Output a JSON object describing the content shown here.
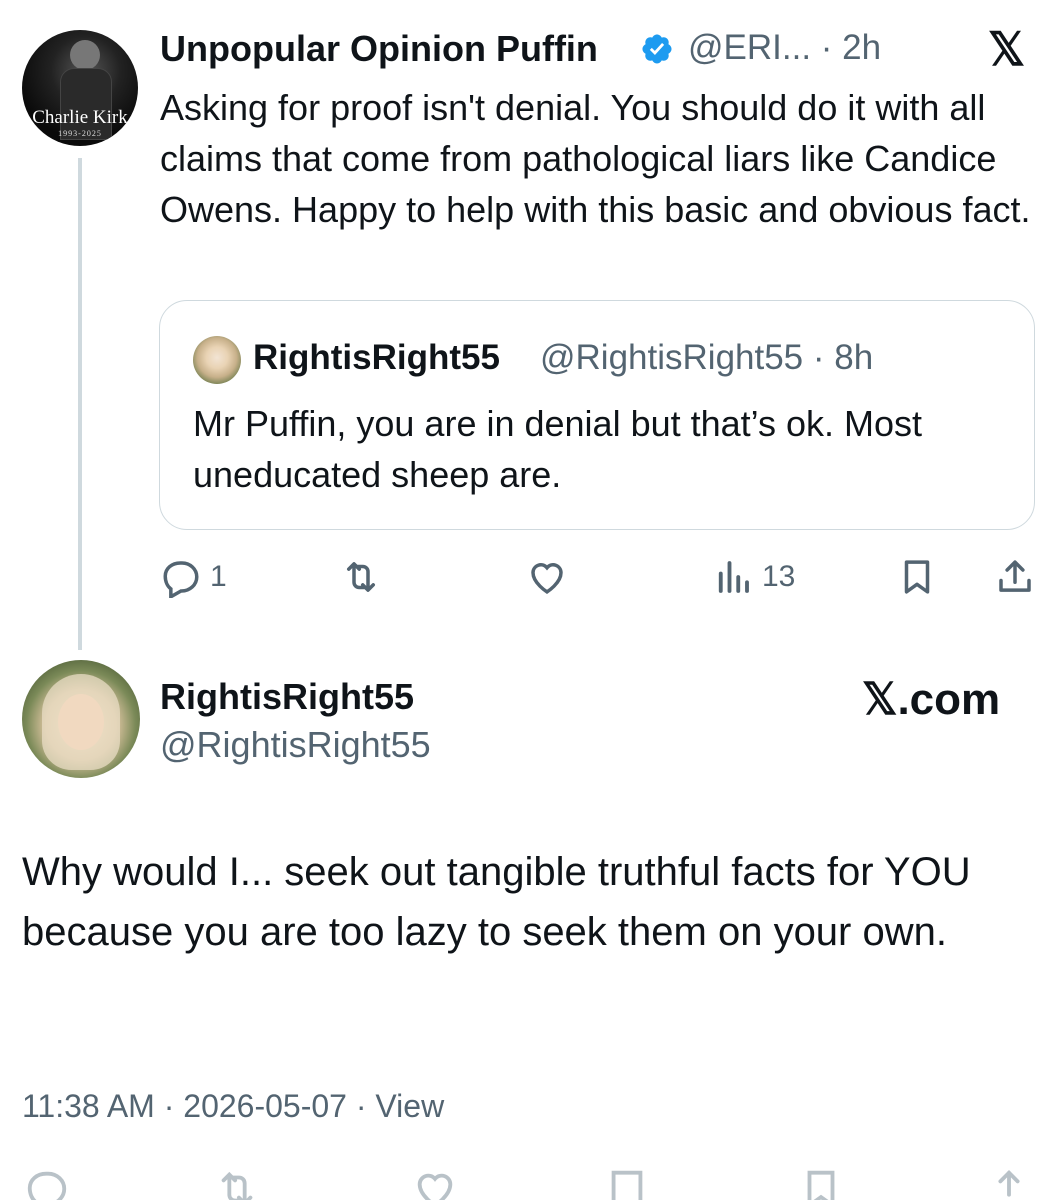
{
  "tweet": {
    "author_name": "Unpopular Opinion Puffin",
    "author_handle": "@ERI...",
    "time": "· 2h",
    "avatar_caption": "Charlie Kirk",
    "avatar_years": "1993-2025",
    "text": "Asking for proof isn't denial. You should do it with all claims that come from pathological liars like Candice Owens. Happy to help with this basic and obvious fact.",
    "quoted": {
      "author_name": "RightisRight55",
      "author_handle": "@RightisRight55",
      "time": "· 8h",
      "text": "Mr Puffin, you are in denial but that’s ok. Most uneducated sheep are."
    },
    "actions": {
      "reply_count": "1",
      "retweet_count": "",
      "like_count": "",
      "views_count": "13"
    }
  },
  "reply": {
    "author_name": "RightisRight55",
    "author_handle": "@RightisRight55",
    "brand": "𝕏.com",
    "text": "Why would I... seek out tangible truthful facts for YOU because you are too lazy to seek them on your own.",
    "meta": "11:38 AM · 2026-05-07 · View"
  },
  "icons": {
    "close": "x-logo-icon",
    "verified": "verified-badge-icon",
    "reply": "reply-icon",
    "retweet": "retweet-icon",
    "like": "heart-icon",
    "views": "views-icon",
    "bookmark": "bookmark-icon",
    "share": "share-icon"
  },
  "colors": {
    "verified": "#1d9bf0",
    "secondary_text": "#536471",
    "border": "#cfd9de"
  }
}
